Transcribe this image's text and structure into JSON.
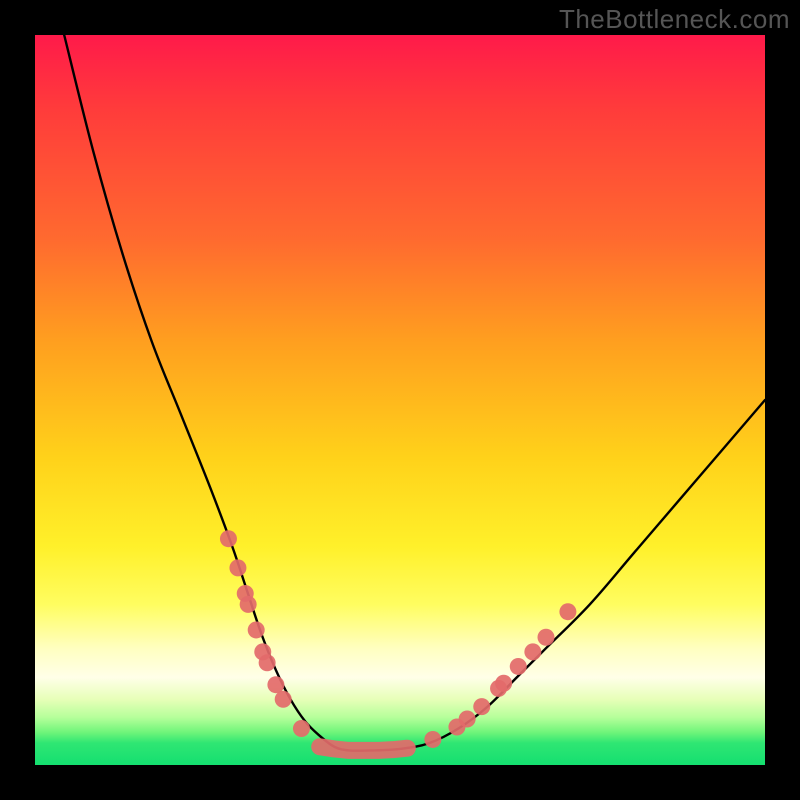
{
  "watermark": "TheBottleneck.com",
  "chart_data": {
    "type": "line",
    "title": "",
    "xlabel": "",
    "ylabel": "",
    "xlim": [
      0,
      100
    ],
    "ylim": [
      0,
      100
    ],
    "grid": false,
    "legend": false,
    "series": [
      {
        "name": "curve",
        "color": "#000000",
        "x": [
          4,
          8,
          12,
          16,
          20,
          24,
          27,
          29,
          31,
          33,
          35,
          37,
          39,
          41,
          43,
          46,
          50,
          54,
          58,
          62,
          66,
          70,
          76,
          82,
          88,
          94,
          100
        ],
        "values": [
          100,
          84,
          70,
          58,
          48,
          38,
          30,
          24,
          18,
          13,
          9,
          6,
          4,
          2.5,
          2,
          2,
          2.2,
          3,
          5,
          8,
          12,
          16,
          22,
          29,
          36,
          43,
          50
        ]
      }
    ],
    "markers": [
      {
        "name": "left-dots",
        "color": "#e36a6a",
        "points": [
          {
            "x": 26.5,
            "y": 31
          },
          {
            "x": 27.8,
            "y": 27
          },
          {
            "x": 28.8,
            "y": 23.5
          },
          {
            "x": 29.2,
            "y": 22
          },
          {
            "x": 30.3,
            "y": 18.5
          },
          {
            "x": 31.2,
            "y": 15.5
          },
          {
            "x": 31.8,
            "y": 14
          },
          {
            "x": 33.0,
            "y": 11
          },
          {
            "x": 34.0,
            "y": 9
          },
          {
            "x": 36.5,
            "y": 5
          }
        ]
      },
      {
        "name": "right-dots",
        "color": "#e36a6a",
        "points": [
          {
            "x": 54.5,
            "y": 3.5
          },
          {
            "x": 57.8,
            "y": 5.2
          },
          {
            "x": 59.2,
            "y": 6.3
          },
          {
            "x": 61.2,
            "y": 8
          },
          {
            "x": 63.5,
            "y": 10.5
          },
          {
            "x": 64.2,
            "y": 11.2
          },
          {
            "x": 66.2,
            "y": 13.5
          },
          {
            "x": 68.2,
            "y": 15.5
          },
          {
            "x": 70.0,
            "y": 17.5
          },
          {
            "x": 73.0,
            "y": 21
          }
        ]
      },
      {
        "name": "bottom-strip",
        "color": "#e36a6a",
        "points": [
          {
            "x": 39.0,
            "y": 2.5
          },
          {
            "x": 41.0,
            "y": 2.2
          },
          {
            "x": 43.0,
            "y": 2.0
          },
          {
            "x": 45.0,
            "y": 2.0
          },
          {
            "x": 47.0,
            "y": 2.0
          },
          {
            "x": 49.0,
            "y": 2.1
          },
          {
            "x": 51.0,
            "y": 2.3
          }
        ]
      }
    ],
    "gradient_stops": [
      {
        "pos": 0.0,
        "color": "#ff1a4a"
      },
      {
        "pos": 0.1,
        "color": "#ff3b3b"
      },
      {
        "pos": 0.28,
        "color": "#ff6a2f"
      },
      {
        "pos": 0.42,
        "color": "#ff9f1f"
      },
      {
        "pos": 0.58,
        "color": "#ffd21a"
      },
      {
        "pos": 0.7,
        "color": "#fff02a"
      },
      {
        "pos": 0.78,
        "color": "#fffd60"
      },
      {
        "pos": 0.84,
        "color": "#ffffc0"
      },
      {
        "pos": 0.88,
        "color": "#ffffe8"
      },
      {
        "pos": 0.91,
        "color": "#e7ffb8"
      },
      {
        "pos": 0.935,
        "color": "#b5ff9a"
      },
      {
        "pos": 0.955,
        "color": "#70f57a"
      },
      {
        "pos": 0.97,
        "color": "#2fe673"
      },
      {
        "pos": 1.0,
        "color": "#14df70"
      }
    ]
  }
}
